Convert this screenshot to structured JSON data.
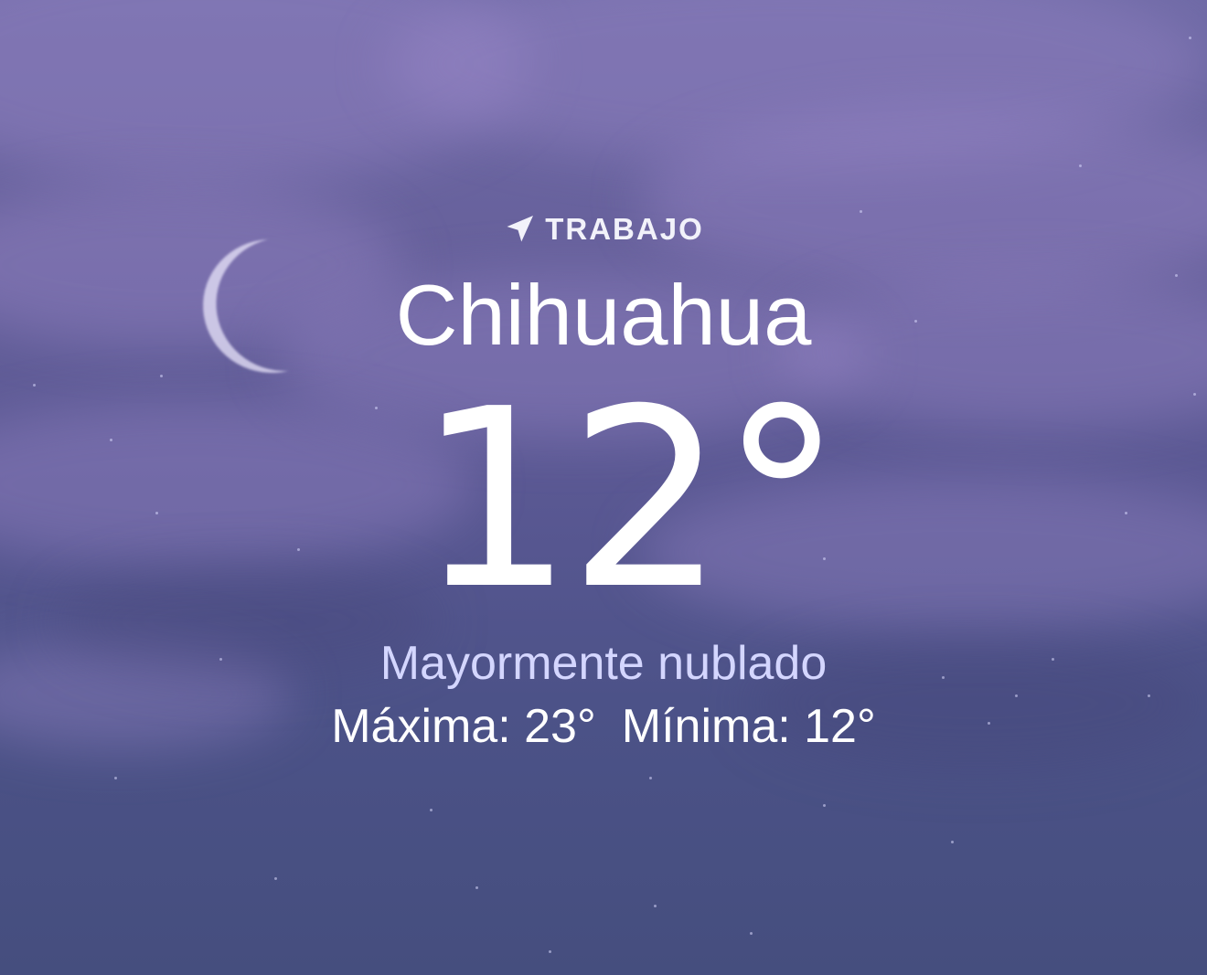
{
  "location": {
    "icon": "location-arrow-icon",
    "label": "TRABAJO"
  },
  "city": "Chihuahua",
  "temperature": "12°",
  "condition": "Mayormente nublado",
  "high": "Máxima: 23°",
  "low": "Mínima: 12°",
  "colors": {
    "sky_top": "#6f6aa6",
    "sky_bottom": "#454e7e",
    "condition_text": "#d4d6ff",
    "text": "#ffffff"
  }
}
